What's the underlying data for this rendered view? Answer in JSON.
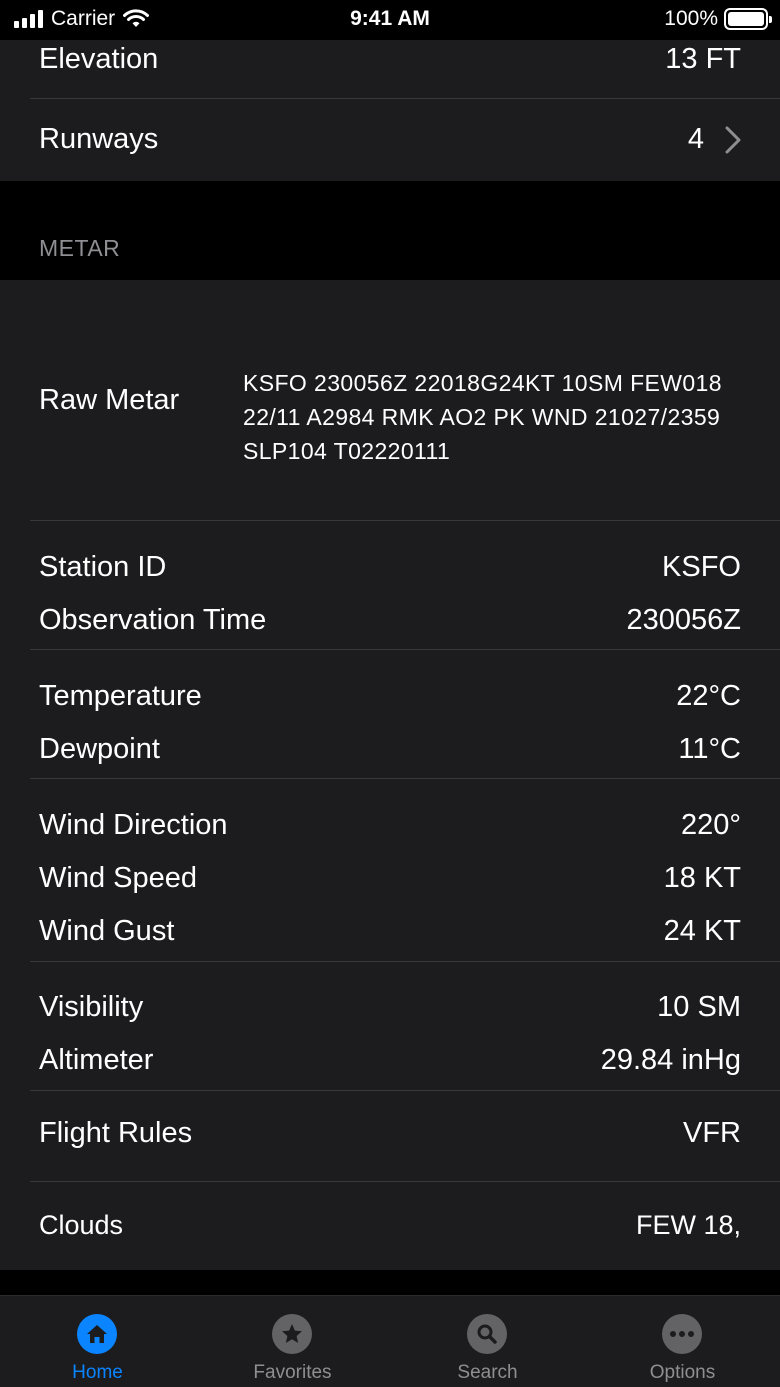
{
  "status_bar": {
    "carrier": "Carrier",
    "time": "9:41 AM",
    "battery": "100%"
  },
  "airport": {
    "elevation_label": "Elevation",
    "elevation_value": "13 FT",
    "runways_label": "Runways",
    "runways_value": "4"
  },
  "metar": {
    "section_title": "METAR",
    "raw_label": "Raw Metar",
    "raw_value": "KSFO 230056Z 22018G24KT 10SM FEW018 22/11 A2984 RMK AO2 PK WND 21027/2359 SLP104 T02220111",
    "station_label": "Station ID",
    "station_value": "KSFO",
    "obs_time_label": "Observation Time",
    "obs_time_value": "230056Z",
    "temp_label": "Temperature",
    "temp_value": "22°C",
    "dewpoint_label": "Dewpoint",
    "dewpoint_value": "11°C",
    "wind_dir_label": "Wind Direction",
    "wind_dir_value": "220°",
    "wind_speed_label": "Wind Speed",
    "wind_speed_value": "18 KT",
    "wind_gust_label": "Wind Gust",
    "wind_gust_value": "24 KT",
    "visibility_label": "Visibility",
    "visibility_value": "10 SM",
    "altimeter_label": "Altimeter",
    "altimeter_value": "29.84 inHg",
    "flight_rules_label": "Flight Rules",
    "flight_rules_value": "VFR",
    "clouds_label": "Clouds",
    "clouds_value": "FEW 18,"
  },
  "tabbar": {
    "home": "Home",
    "favorites": "Favorites",
    "search": "Search",
    "options": "Options"
  },
  "colors": {
    "accent": "#0a84ff",
    "cell_background": "#1c1c1e",
    "inactive": "#8e8e93"
  }
}
